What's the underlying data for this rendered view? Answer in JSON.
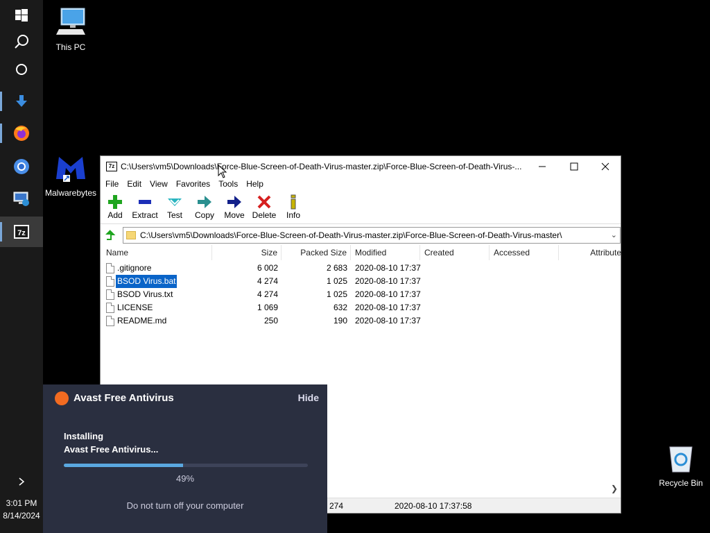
{
  "taskbar": {
    "clock_time": "3:01 PM",
    "clock_date": "8/14/2024",
    "apps": [
      "windows-start",
      "search",
      "task-view",
      "downloads",
      "firefox",
      "chrome",
      "remote-desktop",
      "7zip"
    ],
    "expand_icon": "chevron-right-icon"
  },
  "desktop": {
    "this_pc": "This PC",
    "malwarebytes": "Malwarebytes",
    "recycle_bin": "Recycle Bin"
  },
  "window": {
    "title": "C:\\Users\\vm5\\Downloads\\Force-Blue-Screen-of-Death-Virus-master.zip\\Force-Blue-Screen-of-Death-Virus-...",
    "app_icon_text": "7z",
    "menu": [
      "File",
      "Edit",
      "View",
      "Favorites",
      "Tools",
      "Help"
    ],
    "toolbar": [
      {
        "label": "Add",
        "icon": "plus-icon",
        "color": "#1fa51f"
      },
      {
        "label": "Extract",
        "icon": "minus-icon",
        "color": "#1c2fb8"
      },
      {
        "label": "Test",
        "icon": "check-icon",
        "color": "#2ab5c0"
      },
      {
        "label": "Copy",
        "icon": "arrow-right-icon",
        "color": "#2a8f8f"
      },
      {
        "label": "Move",
        "icon": "arrow-right-icon",
        "color": "#12208a"
      },
      {
        "label": "Delete",
        "icon": "x-icon",
        "color": "#d62020"
      },
      {
        "label": "Info",
        "icon": "info-icon",
        "color": "#c8b400"
      }
    ],
    "address": "C:\\Users\\vm5\\Downloads\\Force-Blue-Screen-of-Death-Virus-master.zip\\Force-Blue-Screen-of-Death-Virus-master\\",
    "columns": [
      "Name",
      "Size",
      "Packed Size",
      "Modified",
      "Created",
      "Accessed",
      "Attribute"
    ],
    "files": [
      {
        "name": ".gitignore",
        "size": "6 002",
        "packed": "2 683",
        "modified": "2020-08-10 17:37"
      },
      {
        "name": "BSOD Virus.bat",
        "size": "4 274",
        "packed": "1 025",
        "modified": "2020-08-10 17:37"
      },
      {
        "name": "BSOD Virus.txt",
        "size": "4 274",
        "packed": "1 025",
        "modified": "2020-08-10 17:37"
      },
      {
        "name": "LICENSE",
        "size": "1 069",
        "packed": "632",
        "modified": "2020-08-10 17:37"
      },
      {
        "name": "README.md",
        "size": "250",
        "packed": "190",
        "modified": "2020-08-10 17:37"
      }
    ],
    "selected_index": 1,
    "status_size": "274",
    "status_modified": "2020-08-10 17:37:58"
  },
  "avast": {
    "title": "Avast Free Antivirus",
    "hide": "Hide",
    "line1": "Installing",
    "line2": "Avast Free Antivirus...",
    "progress": 0.49,
    "percent_text": "49%",
    "warning": "Do not turn off your computer",
    "brand_color": "#f26b21"
  }
}
